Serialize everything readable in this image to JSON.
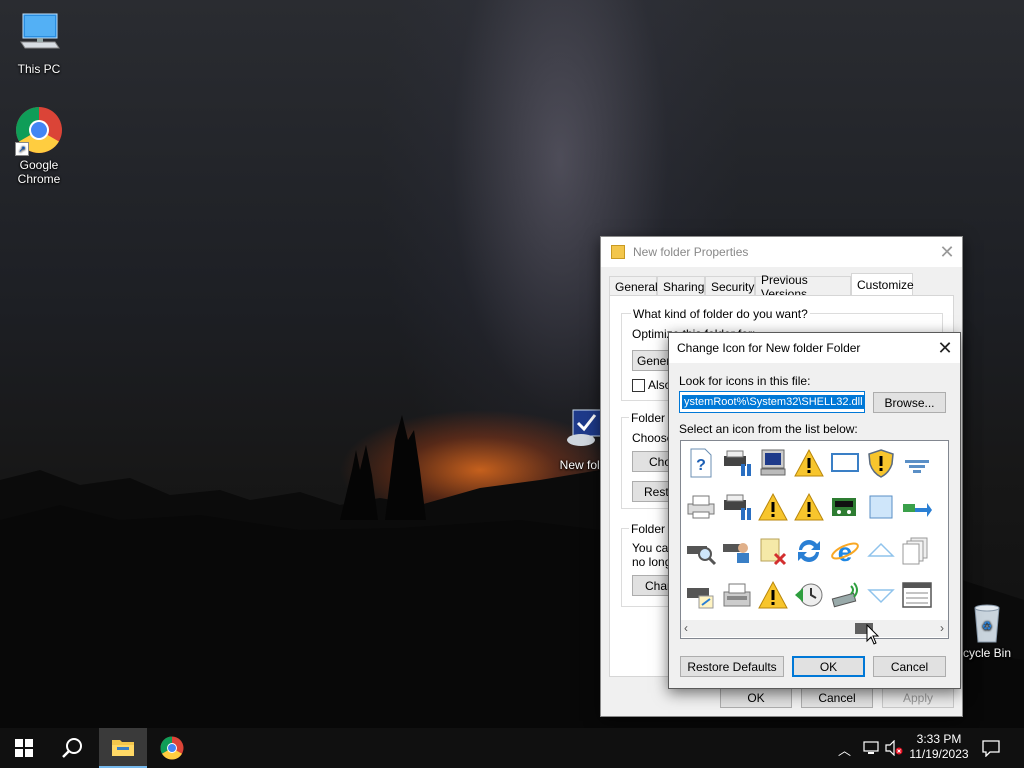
{
  "desktop": {
    "icons": [
      {
        "label": "This PC"
      },
      {
        "label": "Google\nChrome"
      },
      {
        "label": "New fold"
      },
      {
        "label": "cycle Bin"
      }
    ]
  },
  "props_dialog": {
    "title": "New folder Properties",
    "tabs": [
      "General",
      "Sharing",
      "Security",
      "Previous Versions",
      "Customize"
    ],
    "active_tab": "Customize",
    "question": "What kind of folder do you want?",
    "optimize_label": "Optimize this folder for:",
    "optimize_value": "Genera",
    "also_apply": "Also",
    "folder_pictures_heading": "Folder p",
    "choose_text": "Choose",
    "choose_file_btn": "Cho",
    "restore_default_btn": "Resto",
    "folder_icons_heading": "Folder ic",
    "folder_icons_text1": "You ca",
    "folder_icons_text2": "no longe",
    "change_icon_btn": "Chan",
    "ok": "OK",
    "cancel": "Cancel",
    "apply": "Apply"
  },
  "change_icon_dialog": {
    "title": "Change Icon for New folder Folder",
    "look_for_label": "Look for icons in this file:",
    "file_path": "ystemRoot%\\System32\\SHELL32.dll",
    "browse_btn": "Browse...",
    "select_label": "Select an icon from the list below:",
    "restore_defaults_btn": "Restore Defaults",
    "ok": "OK",
    "cancel": "Cancel",
    "icons": [
      [
        "help-file",
        "network-printer",
        "computer-network",
        "warning",
        "monitor",
        "shield-warning",
        "filter",
        "blue-bar"
      ],
      [
        "printer",
        "network-printer",
        "warning",
        "warning",
        "media-device",
        "window-blank",
        "network-arrow",
        "doc-edge"
      ],
      [
        "printer-search",
        "users-group",
        "file-delete",
        "refresh",
        "internet-explorer",
        "triangle-up",
        "documents",
        "doc-edge"
      ],
      [
        "printer-settings",
        "fax",
        "warning",
        "clock-restore",
        "usb-wireless",
        "triangle-down",
        "window-list",
        "doc-edge"
      ]
    ]
  },
  "taskbar": {
    "time": "3:33 PM",
    "date": "11/19/2023"
  },
  "colors": {
    "accent": "#0078d7",
    "taskbar": "#101010",
    "dialog_bg": "#f0f0f0"
  }
}
